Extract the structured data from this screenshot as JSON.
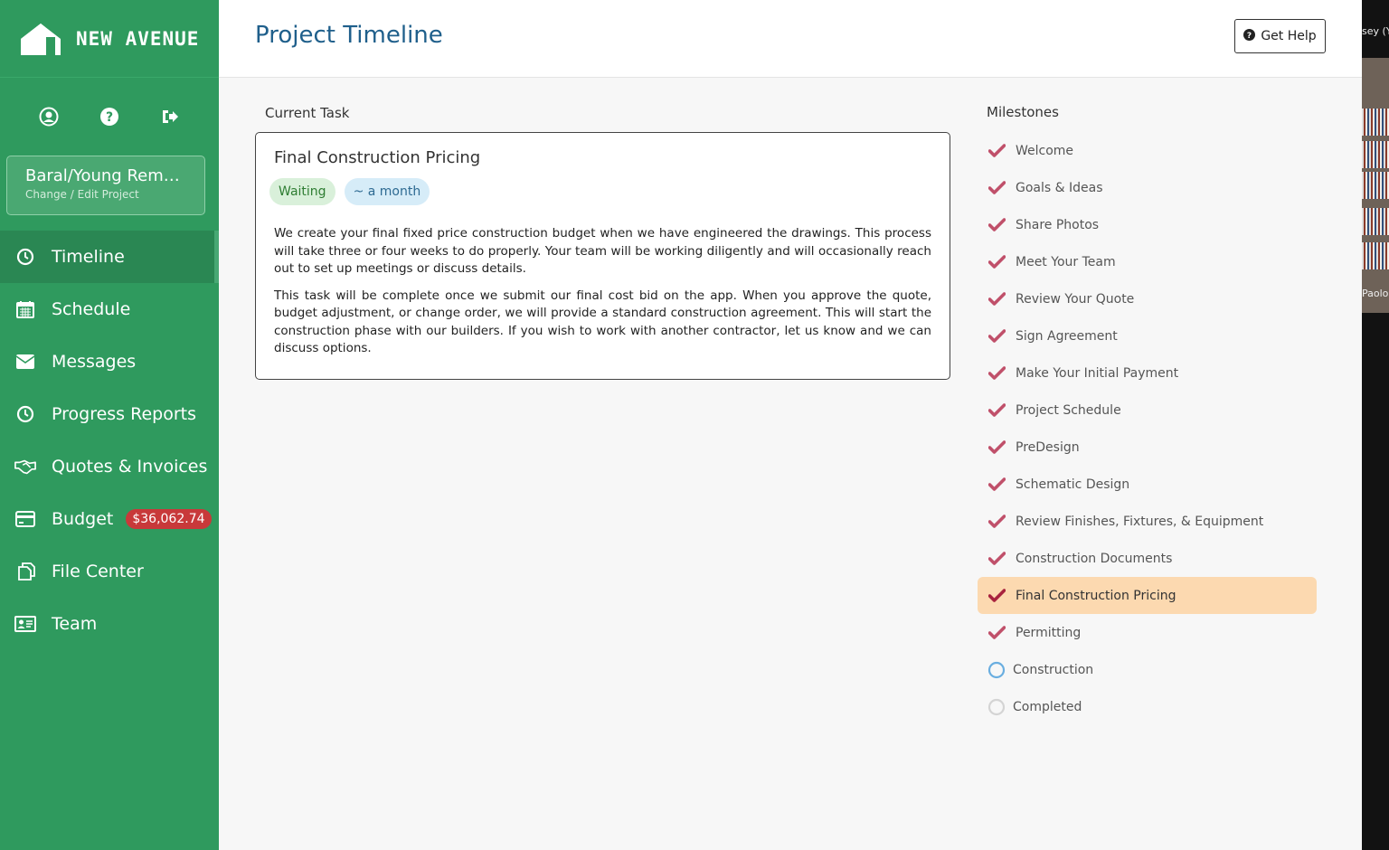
{
  "brand": {
    "name": "NEW AVENUE"
  },
  "sidebar": {
    "top_icons": [
      "user-circle-icon",
      "question-circle-icon",
      "sign-out-icon"
    ],
    "project": {
      "name": "Baral/Young Remo...",
      "sub": "Change / Edit Project"
    },
    "items": [
      {
        "label": "Timeline",
        "icon": "clock-icon",
        "active": true
      },
      {
        "label": "Schedule",
        "icon": "calendar-icon"
      },
      {
        "label": "Messages",
        "icon": "envelope-icon"
      },
      {
        "label": "Progress Reports",
        "icon": "clock-icon"
      },
      {
        "label": "Quotes & Invoices",
        "icon": "handshake-icon"
      },
      {
        "label": "Budget",
        "icon": "credit-card-icon",
        "badge": "$36,062.74"
      },
      {
        "label": "File Center",
        "icon": "files-icon"
      },
      {
        "label": "Team",
        "icon": "id-card-icon"
      }
    ]
  },
  "header": {
    "title": "Project Timeline",
    "help_label": "Get Help"
  },
  "current_task": {
    "section_label": "Current Task",
    "title": "Final Construction Pricing",
    "status": "Waiting",
    "duration": "~ a month",
    "paragraphs": [
      "We create your final fixed price construction budget when we have engineered the drawings. This process will take three or four weeks to do properly. Your team will be working diligently and will occasionally reach out to set up meetings or discuss details.",
      "This task will be complete once we submit our final cost bid on the app. When you approve the quote, budget adjustment, or change order, we will provide a standard construction agreement. This will start the construction phase with our builders. If you wish to work with another contractor, let us know and we can discuss options."
    ]
  },
  "milestones": {
    "section_label": "Milestones",
    "items": [
      {
        "label": "Welcome",
        "state": "done"
      },
      {
        "label": "Goals & Ideas",
        "state": "done"
      },
      {
        "label": "Share Photos",
        "state": "done"
      },
      {
        "label": "Meet Your Team",
        "state": "done"
      },
      {
        "label": "Review Your Quote",
        "state": "done"
      },
      {
        "label": "Sign Agreement",
        "state": "done"
      },
      {
        "label": "Make Your Initial Payment",
        "state": "done"
      },
      {
        "label": "Project Schedule",
        "state": "done"
      },
      {
        "label": "PreDesign",
        "state": "done"
      },
      {
        "label": "Schematic Design",
        "state": "done"
      },
      {
        "label": "Review Finishes, Fixtures, & Equipment",
        "state": "done"
      },
      {
        "label": "Construction Documents",
        "state": "done"
      },
      {
        "label": "Final Construction Pricing",
        "state": "current"
      },
      {
        "label": "Permitting",
        "state": "done"
      },
      {
        "label": "Construction",
        "state": "next"
      },
      {
        "label": "Completed",
        "state": "pending"
      }
    ]
  },
  "edge": {
    "top_text": "sey (Y",
    "bottom_text": "Paolo"
  },
  "colors": {
    "sidebar": "#2f9a5e",
    "accent_title": "#1f5f8b",
    "check": "#c0506a",
    "current_bg": "#fcd9b0",
    "badge": "#c8393a"
  }
}
